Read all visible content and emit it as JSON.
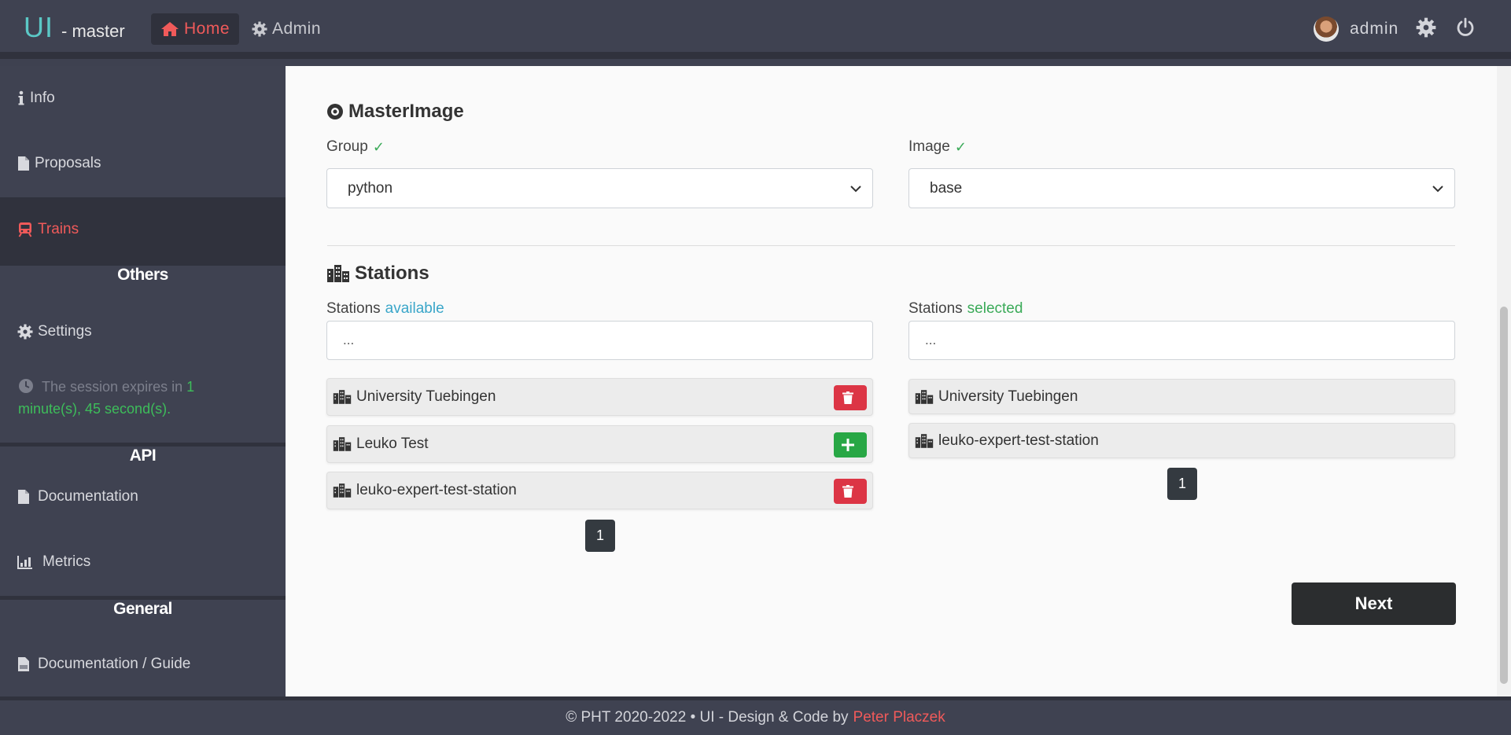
{
  "header": {
    "brand": "UI",
    "brand_suffix": "- master",
    "nav": {
      "home": "Home",
      "admin": "Admin"
    },
    "user": "admin"
  },
  "sidebar": {
    "items": [
      {
        "label": "Info",
        "icon": "info-icon"
      },
      {
        "label": "Proposals",
        "icon": "file-icon"
      },
      {
        "label": "Trains",
        "icon": "train-icon",
        "active": true
      }
    ],
    "others_heading": "Others",
    "settings_label": "Settings",
    "session": {
      "prefix": "The session expires in",
      "time": "1 minute(s), 45 second(s)."
    },
    "api_heading": "API",
    "api_items": [
      {
        "label": "Documentation",
        "icon": "file-icon"
      },
      {
        "label": "Metrics",
        "icon": "chart-icon"
      }
    ],
    "general_heading": "General",
    "general_items": [
      {
        "label": "Documentation / Guide",
        "icon": "pdf-icon"
      }
    ]
  },
  "master_image": {
    "title": "MasterImage",
    "group_label": "Group",
    "group_value": "python",
    "image_label": "Image",
    "image_value": "base"
  },
  "stations": {
    "title": "Stations",
    "available_label": "Stations",
    "available_word": "available",
    "selected_label": "Stations",
    "selected_word": "selected",
    "available_search_placeholder": "...",
    "selected_search_placeholder": "...",
    "available": [
      {
        "name": "University Tuebingen",
        "action": "remove"
      },
      {
        "name": "Leuko Test",
        "action": "add"
      },
      {
        "name": "leuko-expert-test-station",
        "action": "remove"
      }
    ],
    "selected": [
      {
        "name": "University Tuebingen"
      },
      {
        "name": "leuko-expert-test-station"
      }
    ],
    "available_page": "1",
    "selected_page": "1"
  },
  "next_label": "Next",
  "footer": {
    "text": "© PHT 2020-2022 • UI - Design & Code by",
    "author": "Peter Placzek"
  },
  "colors": {
    "accent": "#f05a5a",
    "teal": "#5bc8c6",
    "success": "#28a745",
    "danger": "#dc3545",
    "info": "#3aa6c9"
  }
}
